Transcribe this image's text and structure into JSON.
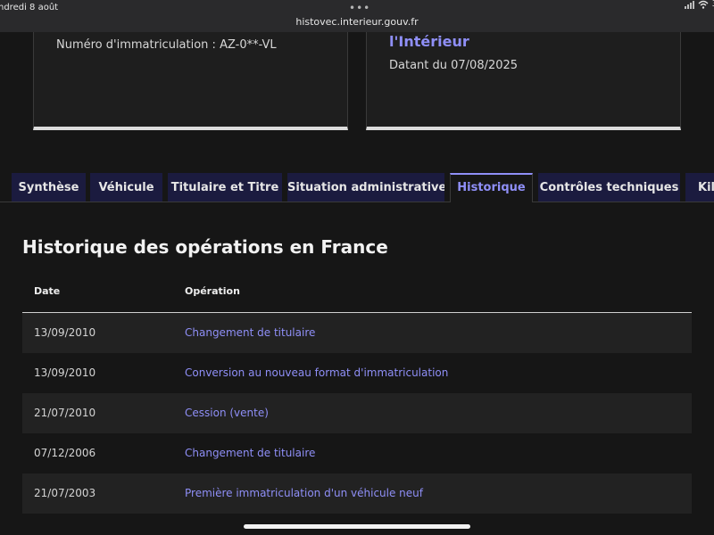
{
  "statusbar": {
    "time_date": "ndredi 8 août",
    "dots": "•••",
    "url": "histovec.interieur.gouv.fr",
    "battery": "3"
  },
  "cards": {
    "left": {
      "plate": "Numéro d'immatriculation : AZ-0**-VL"
    },
    "right": {
      "title": "l'Intérieur",
      "date": "Datant du 07/08/2025"
    }
  },
  "tabs": [
    {
      "label": "Synthèse"
    },
    {
      "label": "Véhicule"
    },
    {
      "label": "Titulaire et Titre"
    },
    {
      "label": "Situation administrative"
    },
    {
      "label": "Historique",
      "active": true
    },
    {
      "label": "Contrôles techniques"
    },
    {
      "label": "Kilo"
    }
  ],
  "history": {
    "title": "Historique des opérations en France",
    "columns": {
      "date": "Date",
      "operation": "Opération"
    },
    "rows": [
      {
        "date": "13/09/2010",
        "operation": "Changement de titulaire"
      },
      {
        "date": "13/09/2010",
        "operation": "Conversion au nouveau format d'immatriculation"
      },
      {
        "date": "21/07/2010",
        "operation": "Cession (vente)"
      },
      {
        "date": "07/12/2006",
        "operation": "Changement de titulaire"
      },
      {
        "date": "21/07/2003",
        "operation": "Première immatriculation d'un véhicule neuf"
      }
    ]
  },
  "colors": {
    "accent": "#8f8ff7",
    "tab_bg": "#1b1b3f",
    "page_bg": "#161616"
  },
  "icons": [
    "signal-icon",
    "wifi-icon"
  ]
}
